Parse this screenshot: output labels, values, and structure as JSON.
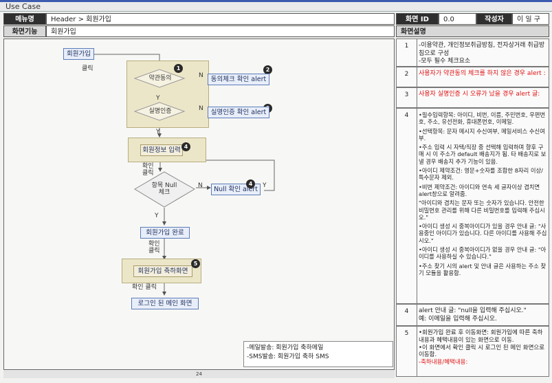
{
  "tab": "Use Case",
  "header": {
    "menu_label": "메뉴명",
    "menu_value": "Header > 회원가입",
    "screen_id_label": "화면 ID",
    "screen_id": "0.0",
    "author_label": "작성자",
    "author": "이 일 구",
    "func_label": "화면기능",
    "func_value": "회원가입",
    "desc_label": "화면설명"
  },
  "flow": {
    "start": "회원가입",
    "click": "클릭",
    "terms": "약관동의",
    "terms_alert": "동의체크 확인 alert",
    "auth": "실명인증",
    "auth_alert": "실명인증 확인 alert",
    "input": "회원정보 입력",
    "confirm_click": "확인\n클릭",
    "null_check": "항목 Null\n체크",
    "null_alert": "Null 확인 alert",
    "done": "회원가입 완료",
    "confirm_click2": "확인\n클릭",
    "congrats": "회원가입 축하화면",
    "confirm_click3": "확인 클릭",
    "main": "로그인 된 메인 화면",
    "y": "Y",
    "n": "N",
    "badges": [
      "1",
      "2",
      "3",
      "4",
      "4",
      "5"
    ]
  },
  "notes": [
    "-메일발송: 회원가입 축하메일",
    "-SMS발송: 회원가입 축하 SMS"
  ],
  "page_number": "24",
  "descriptions": [
    {
      "num": "1",
      "lines": [
        "-이용약관, 개인정보취급방침, 전자상거래 취급방침으로 구성",
        "-모두 필수 체크요소"
      ],
      "red": false
    },
    {
      "num": "2",
      "lines": [
        "사용자가 약관동의 체크를 하지 않은 경우 alert :"
      ],
      "red": true
    },
    {
      "num": "3",
      "lines": [
        "사용자 실명인증 시 오류가 났을 경우 alert 글:"
      ],
      "red": true
    },
    {
      "num": "4",
      "lines": [
        "•필수입력항목: 아이디, 비번, 이름, 주민번호, 우편번호, 주소, 유선전화, 휴대폰번호, 이메일.",
        "•선택항목: 문자 메시지 수신여부, 메일서비스 수신여부.",
        "•주소 입력 시 자택/직장 중 선택해 입력하며 향후 구매 시 이 주소가 default 배송지가 됨. 타 배송지로 보낼 경우 배송지 추가 기능이 있음.",
        "•아이디 제약조건: 영문+숫자를 조합한 8자리 이상/ 특수문자 제외.",
        "•비번 제약조건: 아이디와 연속  세 글자이상 겹치면 alert창으로 알려줌.",
        "\"아이디와 겹치는 문자 또는 숫자가 있습니다. 안전한 비밀번호 관리를 위해 다른 비밀번호를 입력해 주십시오.\"",
        "•아이디 생성 시 중복아이디가 있을 경우 안내 글: \"사용중인 아이디가 있습니다. 다른 아이디를 사용해 주십시오.\"",
        "•아이디 생성 시 중복아이디가 없을 경우 안내 글: \"아이디를 사용하실 수 있습니다.\"",
        "•주소 찾기 시의 alert 및 안내 글은 사용하는 주소 찾기 모듈을 활용함."
      ],
      "red": false
    },
    {
      "num": "4",
      "lines": [
        "alert 안내 글: \"null을 입력해 주십시오.\"",
        "예: 이메일을 입력해 주십시오."
      ],
      "red": false
    },
    {
      "num": "5",
      "lines": [
        "•회원가입 완료 후 이동화면: 회원가입에 따른 축하내용과 혜택내용이 있는 화면으로 이동.",
        "•이 화면에서 확인 클릭 시 로그인 된 메인 화면으로 이동함."
      ],
      "red": false,
      "extra": "-축하내용/혜택내용:"
    }
  ]
}
